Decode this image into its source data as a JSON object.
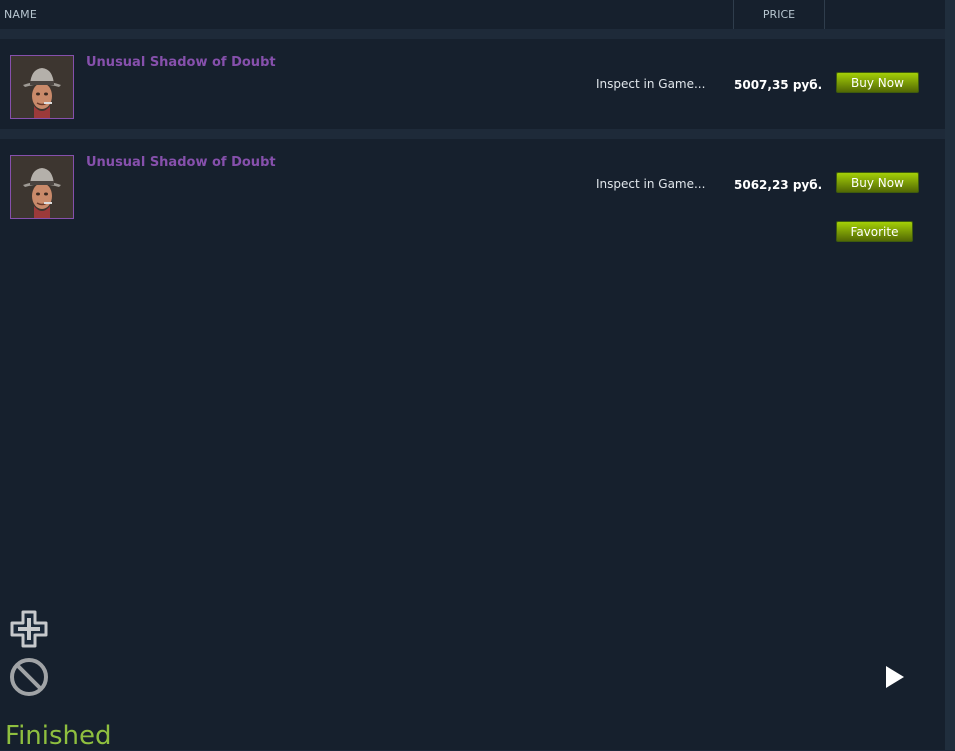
{
  "header": {
    "name_label": "NAME",
    "price_label": "PRICE"
  },
  "listings": [
    {
      "item_name": "Unusual Shadow of Doubt",
      "inspect_label": "Inspect in Game...",
      "price": "5007,35 руб.",
      "buy_label": "Buy Now"
    },
    {
      "item_name": "Unusual Shadow of Doubt",
      "inspect_label": "Inspect in Game...",
      "price": "5062,23 руб.",
      "buy_label": "Buy Now",
      "favorite_label": "Favorite"
    }
  ],
  "controls": {
    "add_icon": "plus-icon",
    "block_icon": "prohibited-icon",
    "play_icon": "play-icon"
  },
  "status": {
    "text": "Finished"
  },
  "colors": {
    "background": "#1b2838",
    "unusual_name": "#8650ac",
    "buy_button": "#a4d007",
    "status_text": "#8fbf3f"
  }
}
